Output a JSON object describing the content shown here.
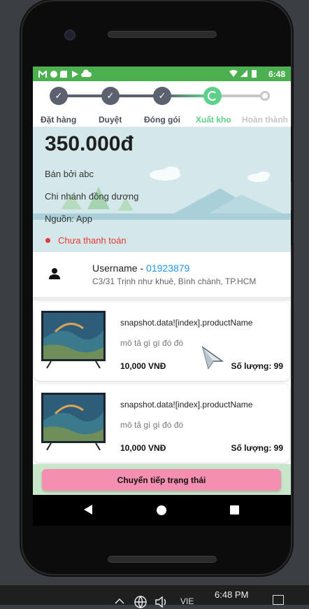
{
  "status_bar": {
    "time": "6:48",
    "left_icons": [
      "gmail-icon",
      "circle-icon",
      "sd-card-icon",
      "play-store-icon",
      "cloud-icon"
    ],
    "right_icons": [
      "wifi-icon",
      "signal-icon",
      "battery-icon"
    ]
  },
  "stepper": {
    "steps": [
      {
        "label": "Đặt hàng",
        "state": "done"
      },
      {
        "label": "Duyệt",
        "state": "done"
      },
      {
        "label": "Đóng gói",
        "state": "done"
      },
      {
        "label": "Xuất kho",
        "state": "active"
      },
      {
        "label": "Hoàn thành",
        "state": "pending"
      }
    ],
    "colors": {
      "done": "#5c6170",
      "active": "#5ed08a",
      "pending": "#c6c6c9"
    }
  },
  "order": {
    "amount": "350.000đ",
    "seller": "Bán bởi abc",
    "branch": "Chi nhánh đồng dương",
    "source": "Nguồn: App",
    "payment_status": "Chưa thanh toán",
    "payment_status_color": "#e53935"
  },
  "customer": {
    "username": "Username",
    "separator": " - ",
    "phone": "01923879",
    "address": "C3/31 Trịnh như khuê, Bình chánh, TP.HCM"
  },
  "products": [
    {
      "name": "snapshot.data![index].productName",
      "description": "mô tả gì gì đó đó",
      "price": "10,000 VNĐ",
      "quantity": "Số lượng: 99"
    },
    {
      "name": "snapshot.data![index].productName",
      "description": "mô tả gì gì đó đó",
      "price": "10,000 VNĐ",
      "quantity": "Số lượng: 99"
    }
  ],
  "action": {
    "label": "Chuyển tiếp trạng thái",
    "color": "#f48fb1"
  },
  "taskbar": {
    "lang": "VIE",
    "time": "6:48 PM"
  }
}
